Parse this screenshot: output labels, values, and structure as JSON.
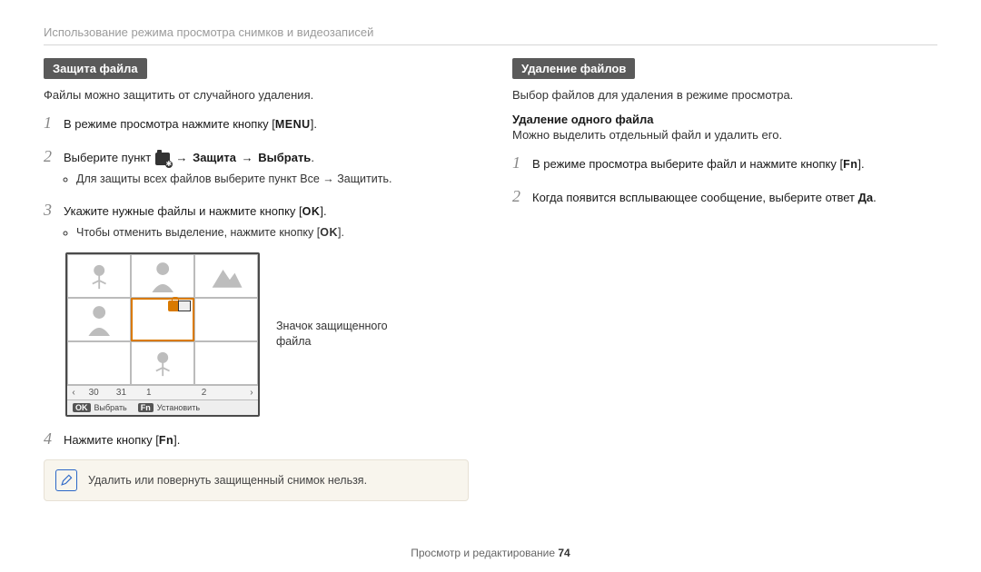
{
  "breadcrumb": "Использование режима просмотра снимков и видеозаписей",
  "left": {
    "section_title": "Защита файла",
    "intro": "Файлы можно защитить от случайного удаления.",
    "steps": {
      "s1_num": "1",
      "s1_a": "В режиме просмотра нажмите кнопку [",
      "s1_menu": "MENU",
      "s1_b": "].",
      "s2_num": "2",
      "s2_a": "Выберите пункт ",
      "s2_arrow1": "→",
      "s2_part1": "Защита",
      "s2_arrow2": "→",
      "s2_part2": "Выбрать",
      "s2_end": ".",
      "s2_bullet": "Для защиты всех файлов выберите пункт Все → Защитить.",
      "s3_num": "3",
      "s3_a": "Укажите нужные файлы и нажмите кнопку [",
      "s3_ok": "OK",
      "s3_b": "].",
      "s3_bullet_a": "Чтобы отменить выделение, нажмите кнопку [",
      "s3_bullet_ok": "OK",
      "s3_bullet_b": "].",
      "s4_num": "4",
      "s4_a": "Нажмите кнопку [",
      "s4_fn": "Fn",
      "s4_b": "]."
    },
    "device": {
      "nums": {
        "left": "‹",
        "n1": "30",
        "n2": "31",
        "n3": "1",
        "n4": "",
        "n5": "2",
        "n6": "",
        "right": "›"
      },
      "legend_ok": "OK",
      "legend_select": "Выбрать",
      "legend_fn": "Fn",
      "legend_set": "Установить"
    },
    "callout": "Значок защищенного файла",
    "note": "Удалить или повернуть защищенный снимок нельзя."
  },
  "right": {
    "section_title": "Удаление файлов",
    "intro": "Выбор файлов для удаления в режиме просмотра.",
    "subhead": "Удаление одного файла",
    "subintro": "Можно выделить отдельный файл и удалить его.",
    "steps": {
      "s1_num": "1",
      "s1_a": "В режиме просмотра выберите файл и нажмите кнопку [",
      "s1_fn": "Fn",
      "s1_b": "].",
      "s2_num": "2",
      "s2_a": "Когда появится всплывающее сообщение, выберите ответ ",
      "s2_bold": "Да",
      "s2_b": "."
    }
  },
  "footer": {
    "section": "Просмотр и редактирование ",
    "page": "74"
  }
}
